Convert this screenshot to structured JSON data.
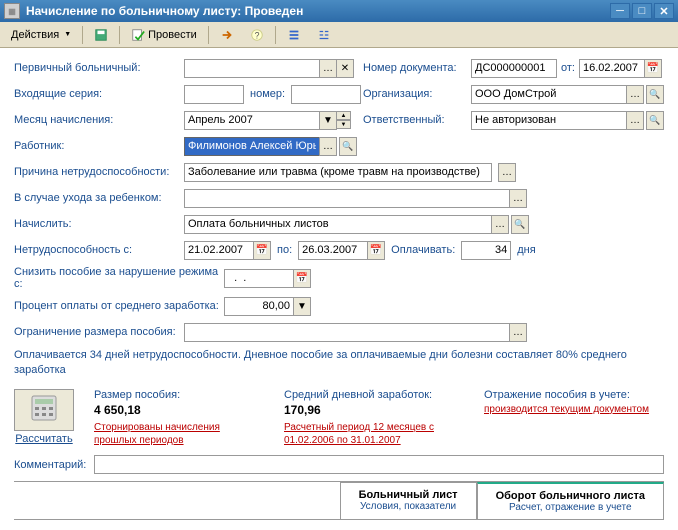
{
  "window": {
    "title": "Начисление по больничному листу: Проведен"
  },
  "toolbar": {
    "actions": "Действия",
    "post": "Провести"
  },
  "labels": {
    "primary": "Первичный больничный:",
    "in_series": "Входящие серия:",
    "number": "номер:",
    "month": "Месяц начисления:",
    "worker": "Работник:",
    "docnum": "Номер документа:",
    "from": "от:",
    "org": "Организация:",
    "resp": "Ответственный:",
    "cause": "Причина нетрудоспособности:",
    "childcare": "В случае ухода за ребенком:",
    "accrue": "Начислить:",
    "disab_from": "Нетрудоспособность с:",
    "to": "по:",
    "pay": "Оплачивать:",
    "days": "дня",
    "reduce": "Снизить пособие за нарушение режима с:",
    "percent": "Процент оплаты от среднего заработка:",
    "limit": "Ограничение размера пособия:",
    "comment": "Комментарий:"
  },
  "values": {
    "month": "Апрель 2007",
    "worker": "Филимонов Алексей Юрьеви",
    "docnum": "ДС000000001",
    "date": "16.02.2007",
    "org": "ООО ДомСтрой",
    "resp": "Не авторизован",
    "cause": "Заболевание или травма (кроме травм на производстве)",
    "accrue": "Оплата больничных листов",
    "from_date": "21.02.2007",
    "to_date": "26.03.2007",
    "pay_days": "34",
    "reduce_date": "  .  .",
    "percent": "80,00"
  },
  "note": "Оплачивается 34 дней нетрудоспособности. Дневное пособие за оплачиваемые дни болезни составляет 80% среднего заработка",
  "calc": {
    "btn": "Рассчитать",
    "size_lbl": "Размер пособия:",
    "size_val": "4 650,18",
    "size_sub": "Сторнированы начисления прошлых периодов",
    "avg_lbl": "Средний дневной заработок:",
    "avg_val": "170,96",
    "avg_sub": "Расчетный период 12 месяцев с 01.02.2006 по 31.01.2007",
    "refl_lbl": "Отражение пособия в учете:",
    "refl_sub": "производится текущим документом"
  },
  "tabs": {
    "t1_title": "Больничный лист",
    "t1_sub": "Условия, показатели",
    "t2_title": "Оборот больничного листа",
    "t2_sub": "Расчет, отражение в учете"
  }
}
